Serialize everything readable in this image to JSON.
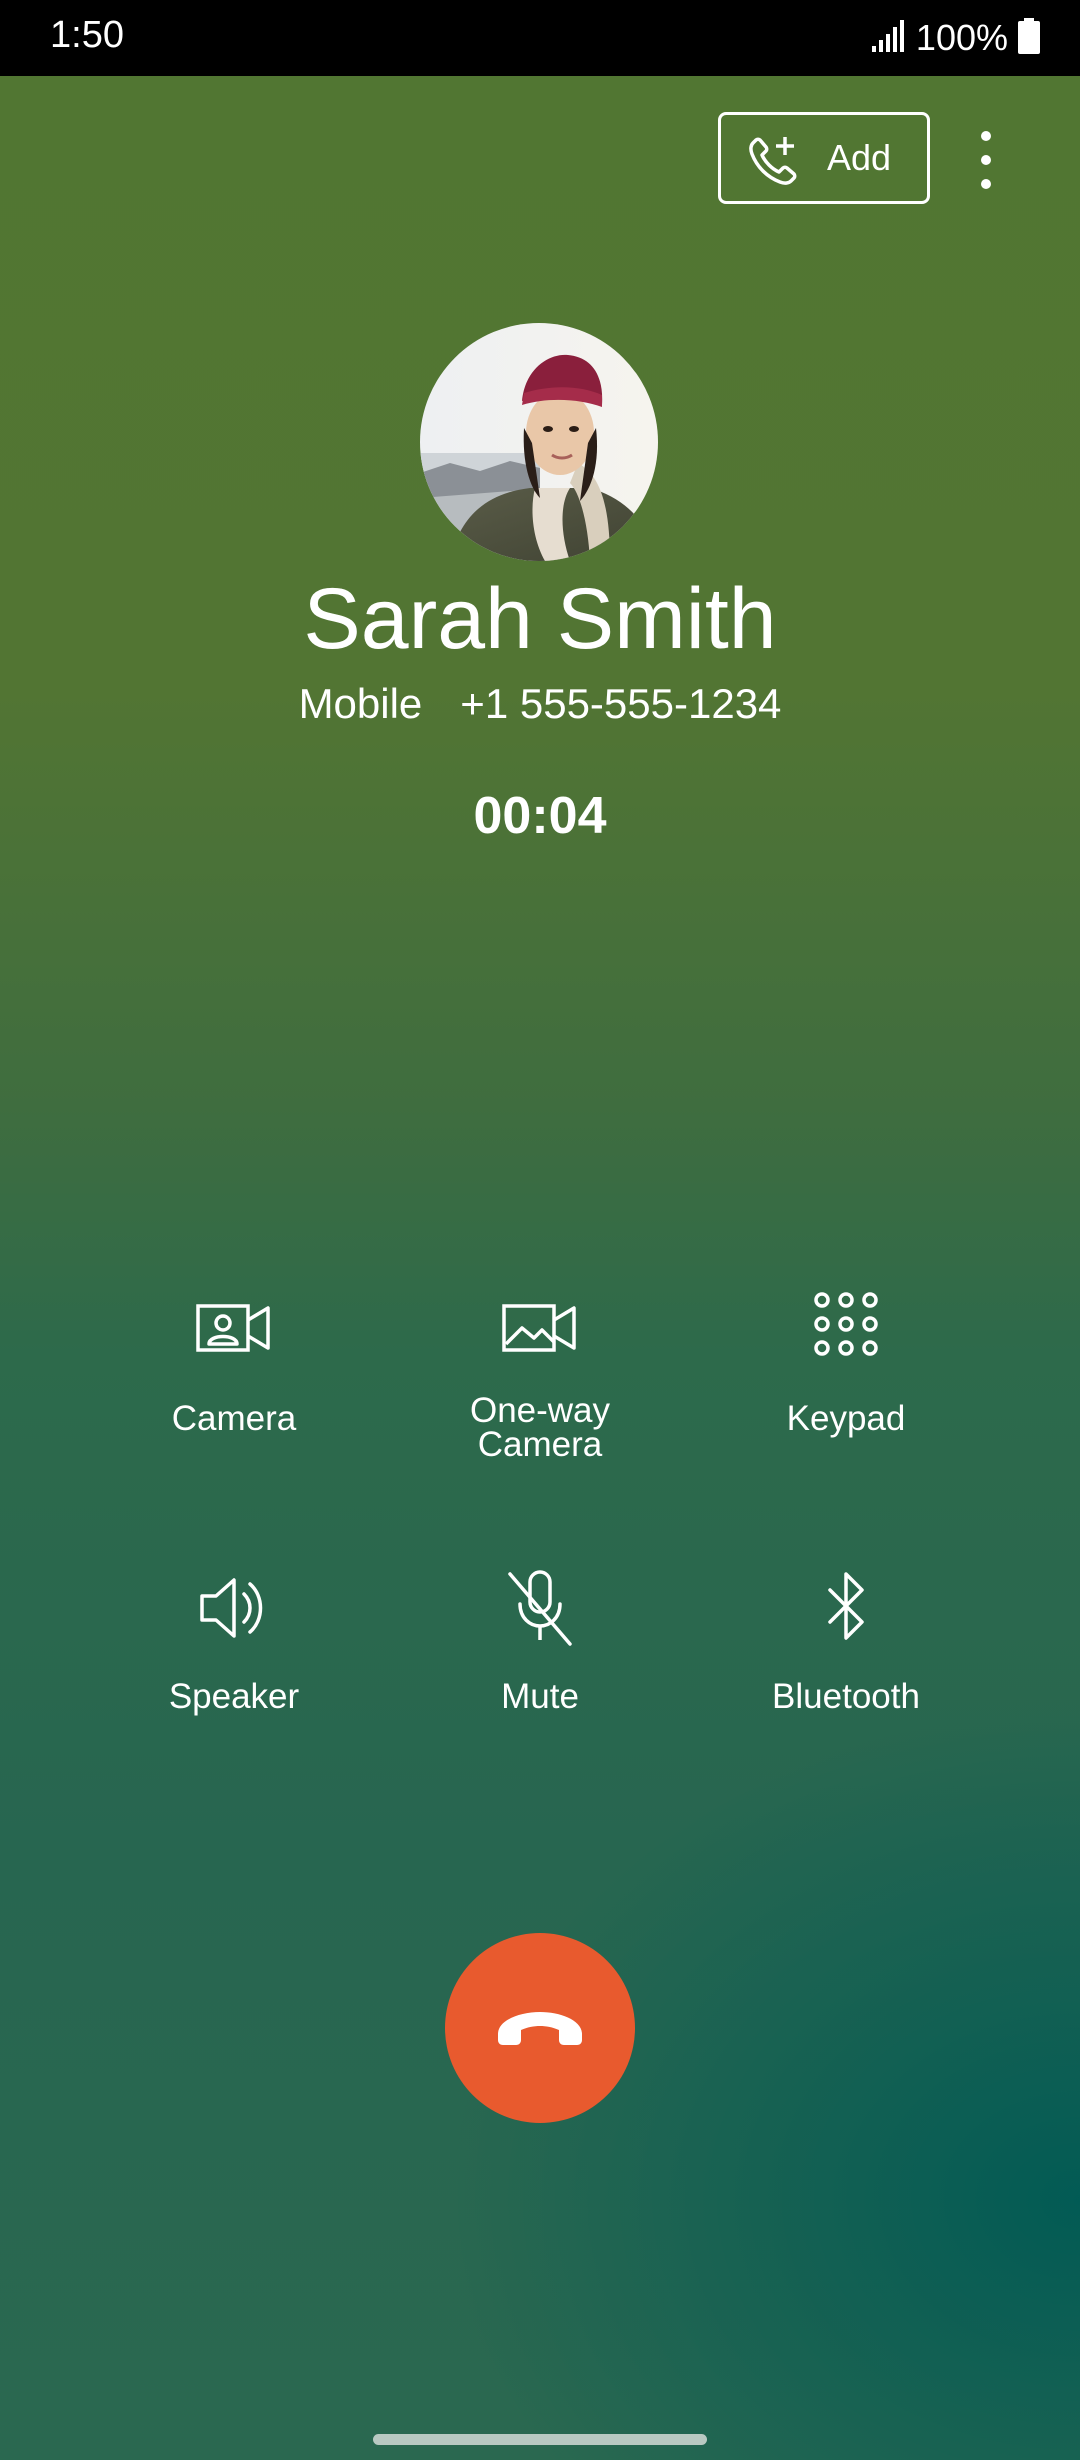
{
  "status_bar": {
    "time": "1:50",
    "battery": "100%",
    "icons": [
      "signal-icon",
      "battery-icon"
    ]
  },
  "top_bar": {
    "add_label": "Add",
    "add_icon": "add-call-icon",
    "more_icon": "more-vert-icon"
  },
  "contact": {
    "name": "Sarah Smith",
    "number_type": "Mobile",
    "number": "+1 555-555-1234",
    "avatar_icon": "contact-photo"
  },
  "call": {
    "timer": "00:04"
  },
  "controls": [
    {
      "label": "Camera",
      "icon": "camera-icon"
    },
    {
      "label": "One-way\nCamera",
      "icon": "one-way-camera-icon"
    },
    {
      "label": "Keypad",
      "icon": "keypad-icon"
    },
    {
      "label": "Speaker",
      "icon": "speaker-icon"
    },
    {
      "label": "Mute",
      "icon": "mic-off-icon"
    },
    {
      "label": "Bluetooth",
      "icon": "bluetooth-icon"
    }
  ],
  "end_call": {
    "icon": "end-call-icon",
    "color": "#e85a2e"
  },
  "colors": {
    "background_top": "#517632",
    "background_bottom": "#005a55",
    "accent": "#e85a2e"
  }
}
